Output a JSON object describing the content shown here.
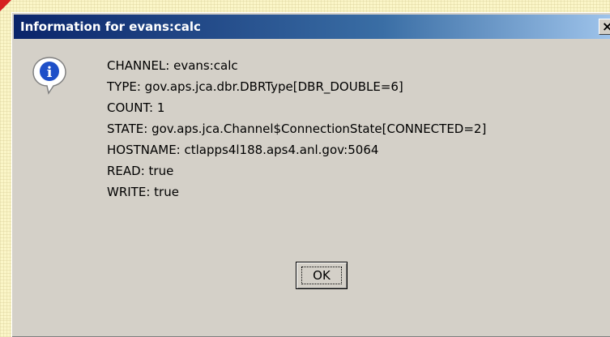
{
  "dialog": {
    "title": "Information for evans:calc",
    "close_glyph": "×"
  },
  "icon": "information-icon",
  "lines": [
    "CHANNEL: evans:calc",
    "TYPE: gov.aps.jca.dbr.DBRType[DBR_DOUBLE=6]",
    "COUNT: 1",
    "STATE: gov.aps.jca.Channel$ConnectionState[CONNECTED=2]",
    "HOSTNAME: ctlapps4l188.aps4.anl.gov:5064",
    "READ: true",
    "WRITE: true"
  ],
  "ok_label": "OK",
  "colors": {
    "titlebar_start": "#0a246a",
    "titlebar_end": "#a6caf0",
    "dialog_bg": "#d4d0c8",
    "desktop_bg": "#fbf6c8"
  }
}
